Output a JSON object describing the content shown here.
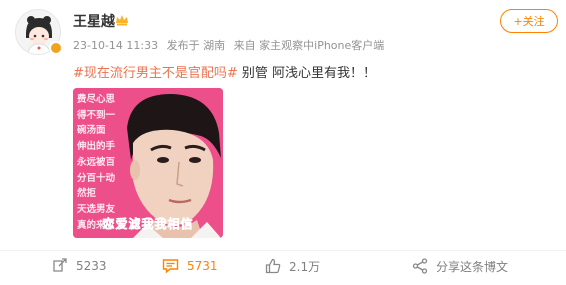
{
  "user": {
    "name": "王星越"
  },
  "meta": {
    "time": "23-10-14 11:33",
    "published_from": "发布于 湖南",
    "source": "来自 家主观察中iPhone客户端"
  },
  "follow_label": "+关注",
  "post": {
    "hashtag": "#现在流行男主不是官配吗#",
    "text": " 别管 阿浅心里有我！！"
  },
  "image": {
    "caption": "费尽心思\n得不到一\n碗汤面\n伸出的手\n永远被百\n分百十动\n然拒\n天选男友\n真的来了",
    "bottom_text": "恋爱滤我我相信"
  },
  "actions": {
    "repost": "5233",
    "comment": "5731",
    "like": "2.1万",
    "share": "分享这条博文"
  },
  "colors": {
    "accent": "#ff8200",
    "hashtag": "#eb7350",
    "image_bg": "#ec4f8a"
  }
}
